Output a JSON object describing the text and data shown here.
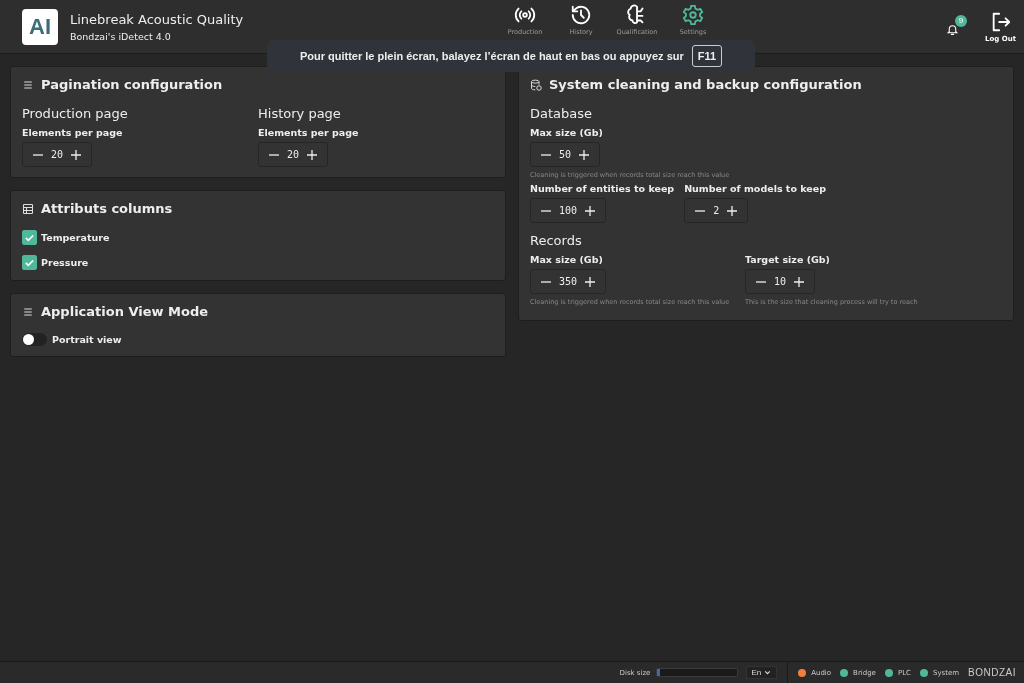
{
  "header": {
    "logo": "AI",
    "title": "Linebreak Acoustic Quality",
    "subtitle": "Bondzai's iDetect 4.0",
    "nav": [
      {
        "label": "Production",
        "kind": "broadcast",
        "selected": false
      },
      {
        "label": "History",
        "kind": "history",
        "selected": false
      },
      {
        "label": "Qualification",
        "kind": "brain",
        "selected": false
      },
      {
        "label": "Settings",
        "kind": "gear",
        "selected": true
      }
    ],
    "notification_count": "9",
    "logout": "Log Out"
  },
  "toast": {
    "text": "Pour quitter le plein écran, balayez l’écran de haut en bas ou appuyez sur",
    "key": "F11"
  },
  "left_panels": [
    {
      "kind": "pagination",
      "title": "Pagination configuration",
      "groups": [
        {
          "heading": "Production page",
          "label": "Elements per page",
          "value": "20"
        },
        {
          "heading": "History page",
          "label": "Elements per page",
          "value": "20"
        }
      ]
    },
    {
      "kind": "columns",
      "title": "Attributs columns",
      "items": [
        {
          "label": "Temperature",
          "checked": true
        },
        {
          "label": "Pressure",
          "checked": true
        }
      ]
    },
    {
      "kind": "viewmode",
      "title": "Application View Mode",
      "toggle": {
        "label": "Portrait view",
        "on": false
      }
    }
  ],
  "system_panel": {
    "title": "System cleaning and backup configuration",
    "database": {
      "heading": "Database",
      "max_label": "Max size (Gb)",
      "max_value": "50",
      "max_hint": "Cleaning is triggered when records total size reach this value",
      "entities_label": "Number of entities to keep",
      "entities_value": "100",
      "models_label": "Number of models to keep",
      "models_value": "2"
    },
    "records": {
      "heading": "Records",
      "max_label": "Max size (Gb)",
      "max_value": "350",
      "max_hint": "Cleaning is triggered when records total size reach this value",
      "target_label": "Target size (Gb)",
      "target_value": "10",
      "target_hint": "This is the size that cleaning process will try to reach"
    }
  },
  "footer": {
    "disk_label": "Disk size",
    "disk": {
      "level": 0.03
    },
    "language": "En",
    "statuses": [
      {
        "label": "Audio",
        "color": "#f07f3c"
      },
      {
        "label": "Bridge",
        "color": "#4fb89a"
      },
      {
        "label": "PLC",
        "color": "#4fb89a"
      },
      {
        "label": "System",
        "color": "#4fb89a"
      }
    ],
    "brand": "BONDZAI"
  }
}
